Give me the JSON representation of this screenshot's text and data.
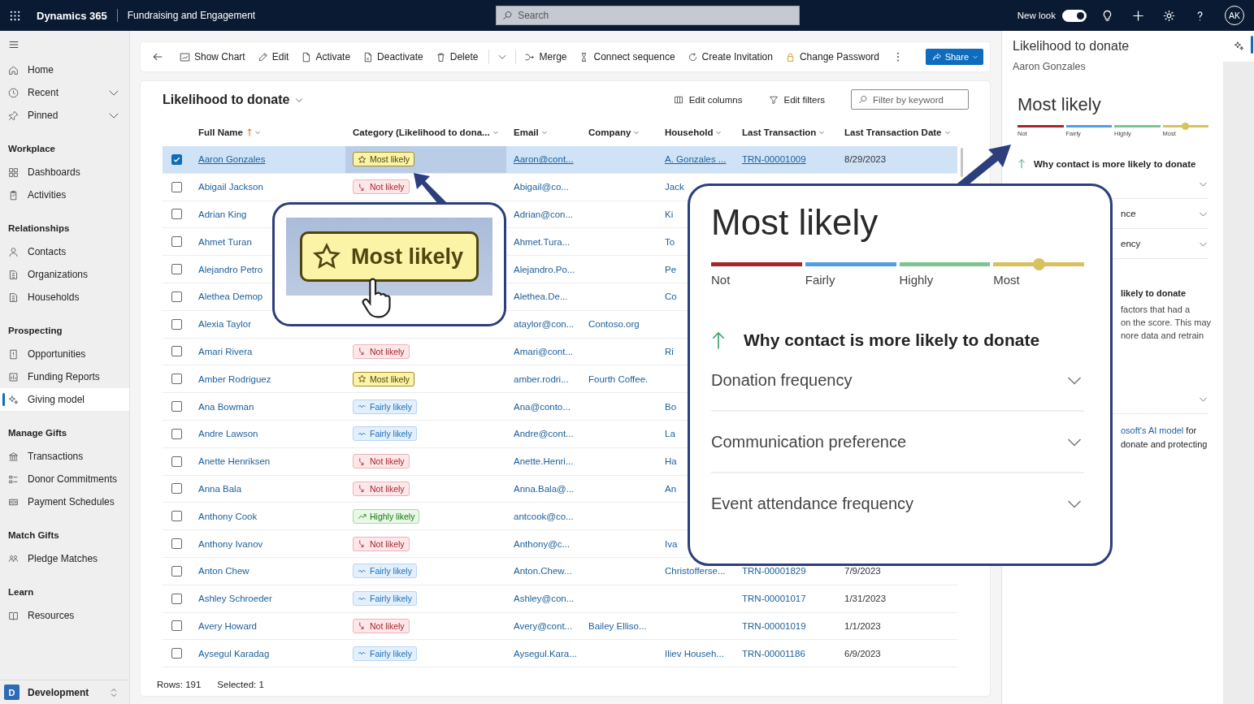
{
  "top_bar": {
    "app_name": "Dynamics 365",
    "area": "Fundraising and Engagement",
    "search_placeholder": "Search",
    "new_look": {
      "label": "New look",
      "on": true
    },
    "avatar": "AK"
  },
  "sidebar": {
    "sections": [
      {
        "items": [
          {
            "label": "Home",
            "kind": "link",
            "selected": false
          },
          {
            "label": "Recent",
            "kind": "flyout",
            "selected": false
          },
          {
            "label": "Pinned",
            "kind": "flyout",
            "selected": false
          }
        ]
      },
      {
        "heading": "Workplace",
        "items": [
          {
            "label": "Dashboards",
            "kind": "link",
            "selected": false
          },
          {
            "label": "Activities",
            "kind": "link",
            "selected": false
          }
        ]
      },
      {
        "heading": "Relationships",
        "items": [
          {
            "label": "Contacts",
            "kind": "link",
            "selected": false
          },
          {
            "label": "Organizations",
            "kind": "link",
            "selected": false
          },
          {
            "label": "Households",
            "kind": "link",
            "selected": false
          }
        ]
      },
      {
        "heading": "Prospecting",
        "items": [
          {
            "label": "Opportunities",
            "kind": "link",
            "selected": false
          },
          {
            "label": "Funding Reports",
            "kind": "link",
            "selected": false
          },
          {
            "label": "Giving model",
            "kind": "link",
            "selected": true
          }
        ]
      },
      {
        "heading": "Manage Gifts",
        "items": [
          {
            "label": "Transactions",
            "kind": "link",
            "selected": false
          },
          {
            "label": "Donor Commitments",
            "kind": "link",
            "selected": false
          },
          {
            "label": "Payment Schedules",
            "kind": "link",
            "selected": false
          }
        ]
      },
      {
        "heading": "Match Gifts",
        "items": [
          {
            "label": "Pledge Matches",
            "kind": "link",
            "selected": false
          }
        ]
      },
      {
        "heading": "Learn",
        "items": [
          {
            "label": "Resources",
            "kind": "link",
            "selected": false
          }
        ]
      }
    ],
    "environment": {
      "initial": "D",
      "name": "Development"
    }
  },
  "command_bar": {
    "commands": [
      {
        "kind": "command",
        "label": "Show Chart"
      },
      {
        "kind": "command",
        "label": "Edit"
      },
      {
        "kind": "command",
        "label": "Activate"
      },
      {
        "kind": "command",
        "label": "Deactivate"
      },
      {
        "kind": "command",
        "label": "Delete"
      },
      {
        "kind": "split"
      },
      {
        "kind": "command",
        "label": "Merge"
      },
      {
        "kind": "command",
        "label": "Connect sequence"
      },
      {
        "kind": "command",
        "label": "Create Invitation"
      },
      {
        "kind": "command",
        "label": "Change Password"
      },
      {
        "kind": "more"
      }
    ],
    "share": "Share"
  },
  "grid": {
    "view_title": "Likelihood to donate",
    "actions": [
      "Edit columns",
      "Edit filters"
    ],
    "filter_placeholder": "Filter by keyword",
    "columns": [
      {
        "label": "Full Name",
        "sorted": true
      },
      {
        "label": "Category (Likelihood to dona...",
        "sorted": false
      },
      {
        "label": "Email",
        "sorted": false
      },
      {
        "label": "Company",
        "sorted": false
      },
      {
        "label": "Household",
        "sorted": false
      },
      {
        "label": "Last Transaction",
        "sorted": false
      },
      {
        "label": "Last Transaction Date",
        "sorted": false
      }
    ],
    "rows": [
      {
        "selected": true,
        "name": "Aaron Gonzales",
        "category": {
          "label": "Most likely",
          "kind": "most"
        },
        "email": "Aaron@cont...",
        "household": "A. Gonzales ...",
        "transaction": "TRN-00001009",
        "date": "8/29/2023"
      },
      {
        "selected": false,
        "name": "Abigail Jackson",
        "category": {
          "label": "Not likely",
          "kind": "not"
        },
        "email": "Abigail@co...",
        "household": "Jack"
      },
      {
        "selected": false,
        "name": "Adrian King",
        "email": "Adrian@con...",
        "household": "Ki"
      },
      {
        "selected": false,
        "name": "Ahmet Turan",
        "email": "Ahmet.Tura...",
        "household": "To"
      },
      {
        "selected": false,
        "name": "Alejandro Petro",
        "email": "Alejandro.Po...",
        "household": "Pe"
      },
      {
        "selected": false,
        "name": "Alethea Demop",
        "email": "Alethea.De...",
        "household": "Co"
      },
      {
        "selected": false,
        "name": "Alexia Taylor",
        "email": "ataylor@con...",
        "company": "Contoso.org"
      },
      {
        "selected": false,
        "name": "Amari Rivera",
        "category": {
          "label": "Not likely",
          "kind": "not"
        },
        "email": "Amari@cont...",
        "household": "Ri"
      },
      {
        "selected": false,
        "name": "Amber Rodriguez",
        "category": {
          "label": "Most likely",
          "kind": "most"
        },
        "email": "amber.rodri...",
        "company": "Fourth Coffee."
      },
      {
        "selected": false,
        "name": "Ana Bowman",
        "category": {
          "label": "Fairly likely",
          "kind": "fairly"
        },
        "email": "Ana@conto...",
        "household": "Bo"
      },
      {
        "selected": false,
        "name": "Andre Lawson",
        "category": {
          "label": "Fairly likely",
          "kind": "fairly"
        },
        "email": "Andre@cont...",
        "household": "La"
      },
      {
        "selected": false,
        "name": "Anette Henriksen",
        "category": {
          "label": "Not likely",
          "kind": "not"
        },
        "email": "Anette.Henri...",
        "household": "Ha"
      },
      {
        "selected": false,
        "name": "Anna Bala",
        "category": {
          "label": "Not likely",
          "kind": "not"
        },
        "email": "Anna.Bala@...",
        "household": "An"
      },
      {
        "selected": false,
        "name": "Anthony Cook",
        "category": {
          "label": "Highly likely",
          "kind": "highly"
        },
        "email": "antcook@co..."
      },
      {
        "selected": false,
        "name": "Anthony Ivanov",
        "category": {
          "label": "Not likely",
          "kind": "not"
        },
        "email": "Anthony@c...",
        "household": "Iva"
      },
      {
        "selected": false,
        "name": "Anton Chew",
        "category": {
          "label": "Fairly likely",
          "kind": "fairly"
        },
        "email": "Anton.Chew...",
        "household": "Christofferse...",
        "transaction": "TRN-00001829",
        "date": "7/9/2023"
      },
      {
        "selected": false,
        "name": "Ashley Schroeder",
        "category": {
          "label": "Fairly likely",
          "kind": "fairly"
        },
        "email": "Ashley@con...",
        "transaction": "TRN-00001017",
        "date": "1/31/2023"
      },
      {
        "selected": false,
        "name": "Avery Howard",
        "category": {
          "label": "Not likely",
          "kind": "not"
        },
        "email": "Avery@cont...",
        "company": "Bailey Elliso...",
        "transaction": "TRN-00001019",
        "date": "1/1/2023"
      },
      {
        "selected": false,
        "name": "Aysegul Karadag",
        "category": {
          "label": "Fairly likely",
          "kind": "fairly"
        },
        "email": "Aysegul.Kara...",
        "household": "Iliev Househ...",
        "transaction": "TRN-00001186",
        "date": "6/9/2023"
      }
    ],
    "footer": {
      "rows": "Rows: 191",
      "selected": "Selected: 1"
    }
  },
  "panel": {
    "title": "Likelihood to donate",
    "contact": "Aaron Gonzales",
    "score": "Most likely",
    "scale": [
      {
        "label": "Not",
        "color": "#a4262c"
      },
      {
        "label": "Fairly",
        "color": "#4f9fe6"
      },
      {
        "label": "Highly",
        "color": "#7cc491"
      },
      {
        "label": "Most",
        "color": "#d8c15f"
      }
    ],
    "level": 0.88,
    "reason": "Why contact is more likely to donate",
    "factors": [
      {
        "expanded": false
      },
      {
        "label": "nce",
        "expanded": false
      },
      {
        "label": "ency",
        "expanded": false
      }
    ],
    "section_heading": "likely to donate",
    "section_lines": [
      "factors that had a",
      "on the score. This may",
      "nore data and retrain"
    ],
    "second_accordion": {
      "expanded": false
    },
    "note_lines": [
      {
        "link": "osoft's AI model",
        "text": " for"
      },
      {
        "text": "donate and protecting"
      }
    ]
  },
  "callouts": {
    "badge": {
      "label": "Most likely",
      "kind": "most"
    },
    "detail": {
      "score": "Most likely",
      "scale": [
        {
          "label": "Not",
          "color": "#a4262c"
        },
        {
          "label": "Fairly",
          "color": "#4f9fe6"
        },
        {
          "label": "Highly",
          "color": "#7cc491"
        },
        {
          "label": "Most",
          "color": "#d8c15f"
        }
      ],
      "level": 0.88,
      "reason": "Why contact is more likely to donate",
      "factors": [
        {
          "label": "Donation frequency",
          "expanded": false
        },
        {
          "label": "Communication preference",
          "expanded": false
        },
        {
          "label": "Event attendance frequency",
          "expanded": false
        }
      ]
    }
  }
}
